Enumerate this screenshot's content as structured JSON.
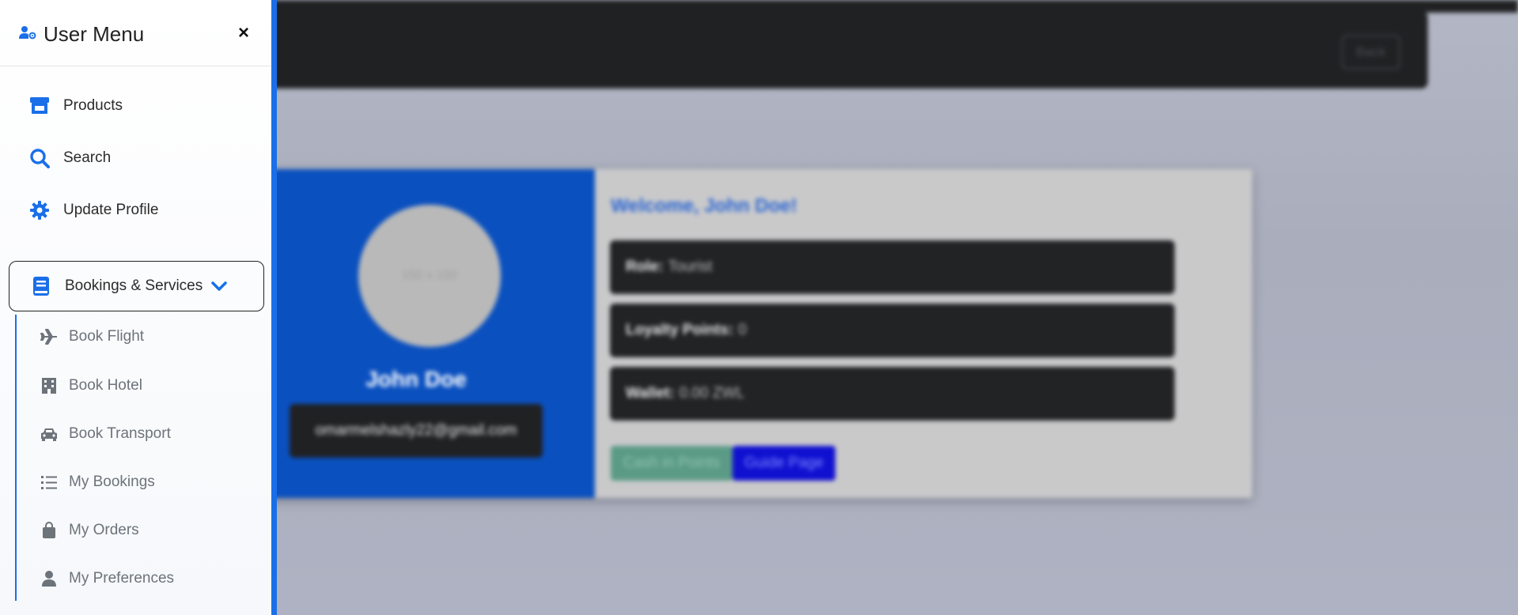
{
  "background": {
    "back_label": "Back",
    "avatar_placeholder": "150 x 150",
    "user_name": "John Doe",
    "user_email": "omarmelshazly22@gmail.com",
    "welcome": "Welcome, John Doe!",
    "info": [
      {
        "label": "Role:",
        "value": "Tourist"
      },
      {
        "label": "Loyalty Points:",
        "value": "0"
      },
      {
        "label": "Wallet:",
        "value": "0.00 ZWL"
      }
    ],
    "cash_button": "Cash in Points",
    "guide_button": "Guide Page"
  },
  "sidebar": {
    "title": "User Menu",
    "close_label": "×",
    "items": [
      {
        "label": "Products",
        "icon": "store-icon"
      },
      {
        "label": "Search",
        "icon": "search-icon"
      },
      {
        "label": "Update Profile",
        "icon": "gear-icon"
      }
    ],
    "group": {
      "label": "Bookings & Services",
      "icon": "book-icon",
      "expanded": true,
      "sub_items": [
        {
          "label": "Book Flight",
          "icon": "plane-icon"
        },
        {
          "label": "Book Hotel",
          "icon": "hotel-icon"
        },
        {
          "label": "Book Transport",
          "icon": "car-icon"
        },
        {
          "label": "My Bookings",
          "icon": "list-icon"
        },
        {
          "label": "My Orders",
          "icon": "bag-icon"
        },
        {
          "label": "My Preferences",
          "icon": "user-icon"
        }
      ]
    }
  },
  "colors": {
    "accent": "#1a6fe8",
    "sub_text": "#6c737b",
    "card_blue": "#0a50bf"
  }
}
